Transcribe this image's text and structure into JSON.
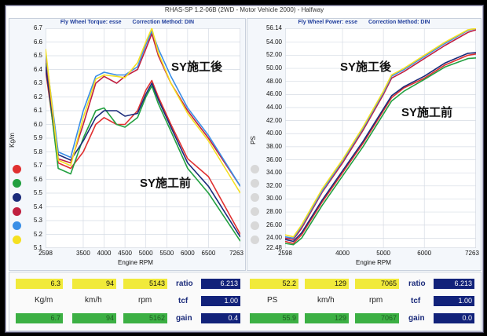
{
  "app_title": "RHAS-SP 1.2-06B  (2WD - Motor Vehicle 2000) - Halfway",
  "torque_panel": {
    "header_left": "Fly Wheel Torque: esse",
    "header_right": "Correction Method: DIN",
    "y_name": "Kg/m",
    "x_name": "Engine RPM",
    "y_ticks": [
      "6.7",
      "6.6",
      "6.5",
      "6.4",
      "6.3",
      "6.2",
      "6.1",
      "6.0",
      "5.9",
      "5.8",
      "5.7",
      "5.6",
      "5.5",
      "5.4",
      "5.3",
      "5.2",
      "5.1"
    ],
    "x_ticks": [
      "2598",
      "3500",
      "4000",
      "4500",
      "5000",
      "5500",
      "6000",
      "6500",
      "7263"
    ],
    "annotation_after": "SY施工後",
    "annotation_before": "SY施工前",
    "legend_colors": [
      "#e03030",
      "#22a040",
      "#1a2a7a",
      "#c02040",
      "#3a8ee6",
      "#f5e020"
    ]
  },
  "power_panel": {
    "header_left": "Fly Wheel Power: esse",
    "header_right": "Correction Method: DIN",
    "y_name": "PS",
    "x_name": "Engine RPM",
    "y_ticks": [
      "56.14",
      "54.00",
      "52.00",
      "50.00",
      "48.00",
      "46.00",
      "44.00",
      "42.00",
      "40.00",
      "38.00",
      "36.00",
      "34.00",
      "32.00",
      "30.00",
      "28.00",
      "26.00",
      "24.00",
      "22.48"
    ],
    "x_ticks": [
      "2598",
      "4000",
      "5000",
      "6000",
      "7263"
    ],
    "annotation_after": "SY施工後",
    "annotation_before": "SY施工前",
    "legend_colors": [
      "#d8d8d8",
      "#d8d8d8",
      "#d8d8d8",
      "#d8d8d8",
      "#d8d8d8",
      "#d8d8d8"
    ]
  },
  "chart_data": [
    {
      "type": "line",
      "title": "Fly Wheel Torque: esse",
      "xlabel": "Engine RPM",
      "ylabel": "Kg/m",
      "xlim": [
        2598,
        7263
      ],
      "ylim": [
        5.1,
        6.7
      ],
      "series": [
        {
          "color": "#e03030",
          "x": [
            2598,
            2900,
            3200,
            3500,
            3800,
            4000,
            4300,
            4500,
            4800,
            5000,
            5143,
            5300,
            5600,
            6000,
            6500,
            7263
          ],
          "values": [
            6.4,
            5.72,
            5.68,
            5.8,
            6.0,
            6.05,
            6.0,
            6.0,
            6.1,
            6.25,
            6.32,
            6.2,
            6.0,
            5.75,
            5.62,
            5.2
          ]
        },
        {
          "color": "#22a040",
          "x": [
            2598,
            2900,
            3200,
            3500,
            3800,
            4000,
            4300,
            4500,
            4800,
            5000,
            5143,
            5300,
            5600,
            6000,
            6500,
            7263
          ],
          "values": [
            6.45,
            5.68,
            5.64,
            5.9,
            6.1,
            6.12,
            6.0,
            5.98,
            6.05,
            6.2,
            6.28,
            6.15,
            5.95,
            5.68,
            5.5,
            5.15
          ]
        },
        {
          "color": "#1a2a7a",
          "x": [
            2598,
            2900,
            3200,
            3500,
            3800,
            4000,
            4300,
            4500,
            4800,
            5000,
            5143,
            5300,
            5600,
            6000,
            6500,
            7263
          ],
          "values": [
            6.42,
            5.78,
            5.74,
            5.88,
            6.05,
            6.1,
            6.1,
            6.06,
            6.08,
            6.22,
            6.3,
            6.18,
            5.98,
            5.72,
            5.55,
            5.18
          ]
        },
        {
          "color": "#c02040",
          "x": [
            2598,
            2900,
            3200,
            3500,
            3800,
            4000,
            4300,
            4500,
            4800,
            5000,
            5143,
            5300,
            5600,
            6000,
            6500,
            7263
          ],
          "values": [
            6.5,
            5.75,
            5.72,
            6.0,
            6.3,
            6.35,
            6.3,
            6.35,
            6.4,
            6.55,
            6.66,
            6.5,
            6.3,
            6.1,
            5.9,
            5.55
          ]
        },
        {
          "color": "#3a8ee6",
          "x": [
            2598,
            2900,
            3200,
            3500,
            3800,
            4000,
            4300,
            4500,
            4800,
            5000,
            5143,
            5300,
            5600,
            6000,
            6500,
            7263
          ],
          "values": [
            6.52,
            5.8,
            5.76,
            6.1,
            6.35,
            6.38,
            6.36,
            6.36,
            6.42,
            6.58,
            6.68,
            6.55,
            6.35,
            6.12,
            5.92,
            5.55
          ]
        },
        {
          "color": "#f5e020",
          "x": [
            2598,
            2900,
            3200,
            3500,
            3800,
            4000,
            4300,
            4500,
            4800,
            5000,
            5143,
            5300,
            5600,
            6000,
            6500,
            7263
          ],
          "values": [
            6.55,
            5.74,
            5.7,
            6.05,
            6.33,
            6.36,
            6.35,
            6.34,
            6.45,
            6.6,
            6.7,
            6.52,
            6.3,
            6.08,
            5.88,
            5.5
          ]
        }
      ]
    },
    {
      "type": "line",
      "title": "Fly Wheel Power: esse",
      "xlabel": "Engine RPM",
      "ylabel": "PS",
      "xlim": [
        2598,
        7263
      ],
      "ylim": [
        22.48,
        56.14
      ],
      "series": [
        {
          "color": "#e03030",
          "x": [
            2598,
            2800,
            3000,
            3500,
            4000,
            4500,
            5000,
            5200,
            5500,
            6000,
            6500,
            7065,
            7263
          ],
          "values": [
            23.5,
            23.2,
            24.5,
            29.5,
            34.0,
            38.5,
            43.5,
            45.5,
            47.0,
            48.5,
            50.5,
            52.0,
            52.2
          ]
        },
        {
          "color": "#22a040",
          "x": [
            2598,
            2800,
            3000,
            3500,
            4000,
            4500,
            5000,
            5200,
            5500,
            6000,
            6500,
            7065,
            7263
          ],
          "values": [
            23.2,
            23.0,
            24.0,
            29.0,
            33.5,
            38.0,
            43.0,
            45.0,
            46.5,
            48.3,
            50.2,
            51.5,
            51.6
          ]
        },
        {
          "color": "#1a2a7a",
          "x": [
            2598,
            2800,
            3000,
            3500,
            4000,
            4500,
            5000,
            5200,
            5500,
            6000,
            6500,
            7065,
            7263
          ],
          "values": [
            23.8,
            23.5,
            24.8,
            29.8,
            34.3,
            38.8,
            43.8,
            45.8,
            47.2,
            48.8,
            50.8,
            52.3,
            52.4
          ]
        },
        {
          "color": "#c02040",
          "x": [
            2598,
            2800,
            3000,
            3500,
            4000,
            4500,
            5000,
            5200,
            5500,
            6000,
            6500,
            7065,
            7263
          ],
          "values": [
            24.0,
            23.8,
            25.5,
            31.0,
            35.5,
            40.5,
            46.0,
            48.5,
            49.5,
            51.5,
            53.5,
            55.5,
            55.9
          ]
        },
        {
          "color": "#3a8ee6",
          "x": [
            2598,
            2800,
            3000,
            3500,
            4000,
            4500,
            5000,
            5200,
            5500,
            6000,
            6500,
            7065,
            7263
          ],
          "values": [
            24.2,
            24.0,
            25.8,
            31.2,
            35.8,
            40.8,
            46.3,
            48.8,
            49.8,
            51.8,
            53.8,
            55.8,
            56.1
          ]
        },
        {
          "color": "#f5e020",
          "x": [
            2598,
            2800,
            3000,
            3500,
            4000,
            4500,
            5000,
            5200,
            5500,
            6000,
            6500,
            7065,
            7263
          ],
          "values": [
            24.5,
            24.2,
            26.0,
            31.5,
            36.0,
            41.0,
            46.5,
            49.0,
            50.0,
            52.0,
            54.0,
            55.9,
            56.1
          ]
        }
      ]
    }
  ],
  "readouts": {
    "torque": {
      "top": [
        "6.3",
        "94",
        "5143"
      ],
      "units": [
        "Kg/m",
        "km/h",
        "rpm"
      ],
      "bottom": [
        "6.7",
        "94",
        "5162"
      ],
      "ratio_label": "ratio",
      "ratio_value": "6.213",
      "tcf_label": "tcf",
      "tcf_value": "1.00",
      "gain_label": "gain",
      "gain_value": "0.4"
    },
    "power": {
      "top": [
        "52.2",
        "129",
        "7065"
      ],
      "units": [
        "PS",
        "km/h",
        "rpm"
      ],
      "bottom": [
        "55.9",
        "129",
        "7067"
      ],
      "ratio_label": "ratio",
      "ratio_value": "6.213",
      "tcf_label": "tcf",
      "tcf_value": "1.00",
      "gain_label": "gain",
      "gain_value": "0.0"
    }
  }
}
